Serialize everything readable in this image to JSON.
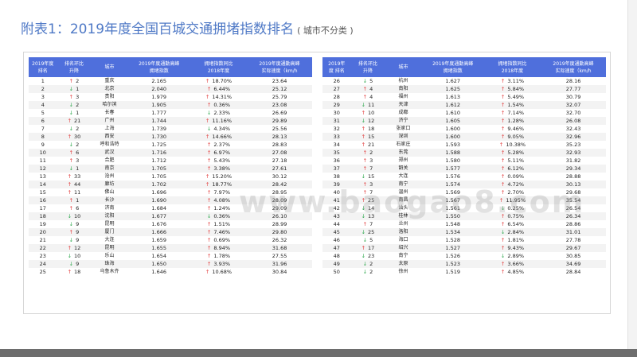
{
  "title": "附表1：2019年度全国百城交通拥堵指数排名",
  "subtitle": "( 城市不分类 )",
  "watermark": "www.baogao8.com",
  "colors": {
    "header_bg": "#4f6fdc",
    "up": "#e23b3b",
    "down": "#2fa84f",
    "title": "#4f79c6"
  },
  "headers": {
    "rank": "2019年度\n排名",
    "change": "排名环比\n升降",
    "city": "城市",
    "index": "2019年度通勤高峰\n拥堵指数",
    "yoy": "拥堵指数同比\n2018年度",
    "speed": "2019年度通勤高峰\n实际速度（km/h"
  },
  "headers_right": {
    "rank": "2019年\n度 排名",
    "change": "排名环比\n升降",
    "city": "城市",
    "index": "2019年度通勤高峰\n拥堵指数",
    "yoy": "拥堵指数同比\n2018年度",
    "speed": "2019年度通勤高峰\n实际速度（km/h"
  },
  "rows": [
    {
      "rank": "1",
      "cdir": "up",
      "chg": "2",
      "city": "重庆",
      "index": "2.165",
      "ydir": "up",
      "yoy": "18.70%",
      "speed": "23.64"
    },
    {
      "rank": "2",
      "cdir": "down",
      "chg": "1",
      "city": "北京",
      "index": "2.040",
      "ydir": "up",
      "yoy": "6.44%",
      "speed": "25.12"
    },
    {
      "rank": "3",
      "cdir": "up",
      "chg": "3",
      "city": "贵阳",
      "index": "1.979",
      "ydir": "up",
      "yoy": "14.31%",
      "speed": "25.79"
    },
    {
      "rank": "4",
      "cdir": "down",
      "chg": "2",
      "city": "哈尔滨",
      "index": "1.905",
      "ydir": "up",
      "yoy": "0.36%",
      "speed": "23.08"
    },
    {
      "rank": "5",
      "cdir": "down",
      "chg": "1",
      "city": "长春",
      "index": "1.777",
      "ydir": "down",
      "yoy": "2.33%",
      "speed": "26.69"
    },
    {
      "rank": "6",
      "cdir": "up",
      "chg": "21",
      "city": "广州",
      "index": "1.744",
      "ydir": "up",
      "yoy": "11.16%",
      "speed": "29.89"
    },
    {
      "rank": "7",
      "cdir": "down",
      "chg": "2",
      "city": "上海",
      "index": "1.739",
      "ydir": "down",
      "yoy": "4.34%",
      "speed": "25.56"
    },
    {
      "rank": "8",
      "cdir": "up",
      "chg": "30",
      "city": "西安",
      "index": "1.730",
      "ydir": "up",
      "yoy": "14.66%",
      "speed": "28.13"
    },
    {
      "rank": "9",
      "cdir": "down",
      "chg": "2",
      "city": "呼和浩特",
      "index": "1.725",
      "ydir": "up",
      "yoy": "2.37%",
      "speed": "28.83"
    },
    {
      "rank": "10",
      "cdir": "up",
      "chg": "6",
      "city": "武汉",
      "index": "1.716",
      "ydir": "up",
      "yoy": "6.97%",
      "speed": "27.08"
    },
    {
      "rank": "11",
      "cdir": "up",
      "chg": "3",
      "city": "合肥",
      "index": "1.712",
      "ydir": "up",
      "yoy": "5.43%",
      "speed": "27.18"
    },
    {
      "rank": "12",
      "cdir": "down",
      "chg": "1",
      "city": "南京",
      "index": "1.705",
      "ydir": "up",
      "yoy": "3.38%",
      "speed": "27.61"
    },
    {
      "rank": "13",
      "cdir": "up",
      "chg": "33",
      "city": "沧州",
      "index": "1.705",
      "ydir": "up",
      "yoy": "15.20%",
      "speed": "30.12"
    },
    {
      "rank": "14",
      "cdir": "up",
      "chg": "44",
      "city": "廊坊",
      "index": "1.702",
      "ydir": "up",
      "yoy": "18.77%",
      "speed": "28.42"
    },
    {
      "rank": "15",
      "cdir": "up",
      "chg": "11",
      "city": "佛山",
      "index": "1.696",
      "ydir": "up",
      "yoy": "7.97%",
      "speed": "28.95"
    },
    {
      "rank": "16",
      "cdir": "up",
      "chg": "1",
      "city": "长沙",
      "index": "1.690",
      "ydir": "up",
      "yoy": "4.08%",
      "speed": "28.09"
    },
    {
      "rank": "17",
      "cdir": "up",
      "chg": "6",
      "city": "济南",
      "index": "1.684",
      "ydir": "up",
      "yoy": "1.24%",
      "speed": "29.09"
    },
    {
      "rank": "18",
      "cdir": "down",
      "chg": "10",
      "city": "沈阳",
      "index": "1.677",
      "ydir": "down",
      "yoy": "0.36%",
      "speed": "26.10"
    },
    {
      "rank": "19",
      "cdir": "down",
      "chg": "9",
      "city": "昆明",
      "index": "1.676",
      "ydir": "up",
      "yoy": "1.51%",
      "speed": "28.99"
    },
    {
      "rank": "20",
      "cdir": "up",
      "chg": "9",
      "city": "厦门",
      "index": "1.666",
      "ydir": "up",
      "yoy": "7.46%",
      "speed": "29.80"
    },
    {
      "rank": "21",
      "cdir": "down",
      "chg": "9",
      "city": "大连",
      "index": "1.659",
      "ydir": "up",
      "yoy": "0.69%",
      "speed": "26.32"
    },
    {
      "rank": "22",
      "cdir": "up",
      "chg": "12",
      "city": "昆明",
      "index": "1.655",
      "ydir": "up",
      "yoy": "8.94%",
      "speed": "31.68"
    },
    {
      "rank": "23",
      "cdir": "down",
      "chg": "10",
      "city": "乐山",
      "index": "1.654",
      "ydir": "up",
      "yoy": "1.78%",
      "speed": "27.55"
    },
    {
      "rank": "24",
      "cdir": "down",
      "chg": "9",
      "city": "珠海",
      "index": "1.650",
      "ydir": "up",
      "yoy": "3.93%",
      "speed": "31.96"
    },
    {
      "rank": "25",
      "cdir": "up",
      "chg": "18",
      "city": "乌鲁木齐",
      "index": "1.646",
      "ydir": "up",
      "yoy": "10.68%",
      "speed": "30.84"
    }
  ],
  "rows_right": [
    {
      "rank": "26",
      "cdir": "down",
      "chg": "5",
      "city": "杭州",
      "index": "1.627",
      "ydir": "up",
      "yoy": "3.11%",
      "speed": "28.16"
    },
    {
      "rank": "27",
      "cdir": "up",
      "chg": "4",
      "city": "南阳",
      "index": "1.625",
      "ydir": "up",
      "yoy": "5.84%",
      "speed": "27.77"
    },
    {
      "rank": "28",
      "cdir": "up",
      "chg": "4",
      "city": "福州",
      "index": "1.613",
      "ydir": "up",
      "yoy": "5.49%",
      "speed": "30.79"
    },
    {
      "rank": "29",
      "cdir": "down",
      "chg": "11",
      "city": "天津",
      "index": "1.612",
      "ydir": "up",
      "yoy": "1.54%",
      "speed": "32.07"
    },
    {
      "rank": "30",
      "cdir": "up",
      "chg": "10",
      "city": "成都",
      "index": "1.610",
      "ydir": "up",
      "yoy": "7.14%",
      "speed": "32.70"
    },
    {
      "rank": "31",
      "cdir": "down",
      "chg": "12",
      "city": "济宁",
      "index": "1.605",
      "ydir": "up",
      "yoy": "1.28%",
      "speed": "26.08"
    },
    {
      "rank": "32",
      "cdir": "up",
      "chg": "18",
      "city": "张家口",
      "index": "1.600",
      "ydir": "up",
      "yoy": "9.46%",
      "speed": "32.43"
    },
    {
      "rank": "33",
      "cdir": "up",
      "chg": "15",
      "city": "深圳",
      "index": "1.600",
      "ydir": "up",
      "yoy": "9.05%",
      "speed": "32.96"
    },
    {
      "rank": "34",
      "cdir": "up",
      "chg": "21",
      "city": "石家庄",
      "index": "1.593",
      "ydir": "up",
      "yoy": "10.38%",
      "speed": "35.23"
    },
    {
      "rank": "35",
      "cdir": "up",
      "chg": "2",
      "city": "东莞",
      "index": "1.588",
      "ydir": "up",
      "yoy": "5.28%",
      "speed": "32.93"
    },
    {
      "rank": "36",
      "cdir": "up",
      "chg": "3",
      "city": "郑州",
      "index": "1.580",
      "ydir": "up",
      "yoy": "5.11%",
      "speed": "31.82"
    },
    {
      "rank": "37",
      "cdir": "up",
      "chg": "7",
      "city": "韶关",
      "index": "1.577",
      "ydir": "up",
      "yoy": "6.12%",
      "speed": "29.34"
    },
    {
      "rank": "38",
      "cdir": "down",
      "chg": "15",
      "city": "大连",
      "index": "1.576",
      "ydir": "up",
      "yoy": "0.09%",
      "speed": "28.88"
    },
    {
      "rank": "39",
      "cdir": "up",
      "chg": "3",
      "city": "南宁",
      "index": "1.574",
      "ydir": "up",
      "yoy": "4.72%",
      "speed": "30.13"
    },
    {
      "rank": "40",
      "cdir": "up",
      "chg": "7",
      "city": "温州",
      "index": "1.569",
      "ydir": "up",
      "yoy": "2.70%",
      "speed": "29.68"
    },
    {
      "rank": "41",
      "cdir": "up",
      "chg": "25",
      "city": "南昌",
      "index": "1.567",
      "ydir": "up",
      "yoy": "11.95%",
      "speed": "35.54"
    },
    {
      "rank": "42",
      "cdir": "down",
      "chg": "14",
      "city": "汕头",
      "index": "1.561",
      "ydir": "down",
      "yoy": "0.25%",
      "speed": "26.54"
    },
    {
      "rank": "43",
      "cdir": "down",
      "chg": "13",
      "city": "桂林",
      "index": "1.550",
      "ydir": "up",
      "yoy": "0.75%",
      "speed": "26.34"
    },
    {
      "rank": "44",
      "cdir": "up",
      "chg": "7",
      "city": "兰州",
      "index": "1.548",
      "ydir": "up",
      "yoy": "6.54%",
      "speed": "28.86"
    },
    {
      "rank": "45",
      "cdir": "down",
      "chg": "25",
      "city": "洛阳",
      "index": "1.534",
      "ydir": "down",
      "yoy": "2.84%",
      "speed": "31.01"
    },
    {
      "rank": "46",
      "cdir": "down",
      "chg": "5",
      "city": "海口",
      "index": "1.528",
      "ydir": "up",
      "yoy": "1.81%",
      "speed": "27.78"
    },
    {
      "rank": "47",
      "cdir": "up",
      "chg": "17",
      "city": "绍兴",
      "index": "1.527",
      "ydir": "up",
      "yoy": "9.43%",
      "speed": "29.67"
    },
    {
      "rank": "48",
      "cdir": "down",
      "chg": "23",
      "city": "南宁",
      "index": "1.526",
      "ydir": "down",
      "yoy": "2.89%",
      "speed": "30.85"
    },
    {
      "rank": "49",
      "cdir": "down",
      "chg": "2",
      "city": "太原",
      "index": "1.523",
      "ydir": "up",
      "yoy": "3.66%",
      "speed": "34.69"
    },
    {
      "rank": "50",
      "cdir": "down",
      "chg": "2",
      "city": "徐州",
      "index": "1.519",
      "ydir": "up",
      "yoy": "4.85%",
      "speed": "28.84"
    }
  ]
}
